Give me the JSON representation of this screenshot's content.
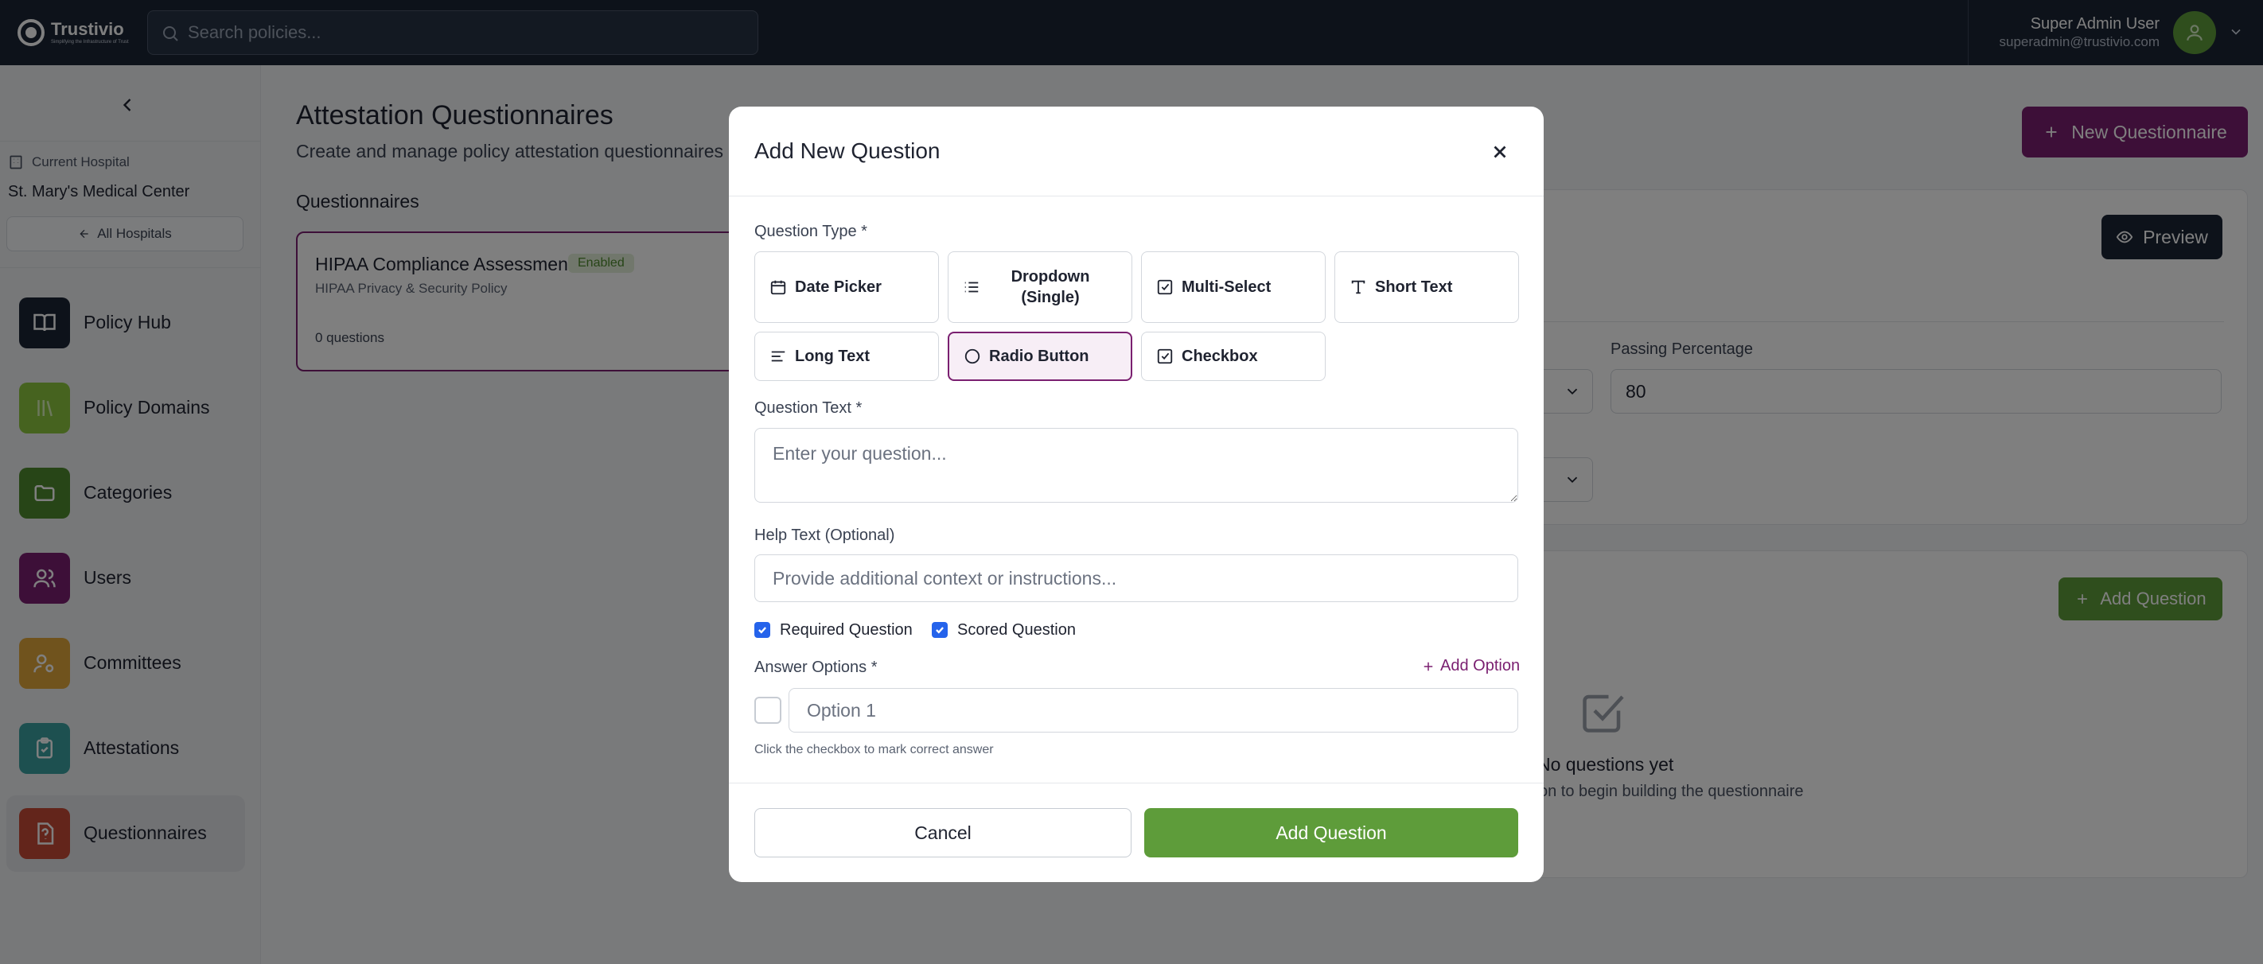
{
  "header": {
    "logo_name": "Trustivio",
    "logo_tagline": "Simplifying the Infrastructure of Trust",
    "search_placeholder": "Search policies...",
    "user_name": "Super Admin User",
    "user_email": "superadmin@trustivio.com"
  },
  "sidebar": {
    "current_hospital_label": "Current Hospital",
    "hospital_name": "St. Mary's Medical Center",
    "all_hospitals_label": "All Hospitals",
    "items": [
      {
        "label": "Policy Hub",
        "icon": "book-icon",
        "color": "#1b2535"
      },
      {
        "label": "Policy Domains",
        "icon": "library-icon",
        "color": "#8cc63f"
      },
      {
        "label": "Categories",
        "icon": "folder-icon",
        "color": "#4f8a2e"
      },
      {
        "label": "Users",
        "icon": "users-icon",
        "color": "#7a1f70"
      },
      {
        "label": "Committees",
        "icon": "committee-icon",
        "color": "#e0a63a"
      },
      {
        "label": "Attestations",
        "icon": "clipboard-check-icon",
        "color": "#3aa0a0"
      },
      {
        "label": "Questionnaires",
        "icon": "file-question-icon",
        "color": "#c64a36"
      }
    ],
    "active_item": "Questionnaires"
  },
  "main": {
    "title": "Attestation Questionnaires",
    "subtitle": "Create and manage policy attestation questionnaires",
    "new_button": "New Questionnaire",
    "list_heading": "Questionnaires",
    "card": {
      "title": "HIPAA Compliance Assessment",
      "badge": "Enabled",
      "policy": "HIPAA Privacy & Security Policy",
      "count": "0 questions"
    },
    "preview_button": "Preview",
    "passing_percentage_label": "Passing Percentage",
    "passing_percentage_value": "80",
    "add_question_button": "Add Question",
    "empty_title": "No questions yet",
    "empty_sub": "on to begin building the questionnaire"
  },
  "modal": {
    "title": "Add New Question",
    "question_type_label": "Question Type *",
    "types": [
      {
        "label": "Date Picker",
        "icon": "calendar-icon"
      },
      {
        "label": "Dropdown (Single)",
        "icon": "list-icon"
      },
      {
        "label": "Multi-Select",
        "icon": "check-square-icon"
      },
      {
        "label": "Short Text",
        "icon": "type-icon"
      },
      {
        "label": "Long Text",
        "icon": "align-left-icon"
      },
      {
        "label": "Radio Button",
        "icon": "circle-icon"
      },
      {
        "label": "Checkbox",
        "icon": "check-square-icon"
      }
    ],
    "selected_type": "Radio Button",
    "question_text_label": "Question Text *",
    "question_text_placeholder": "Enter your question...",
    "help_text_label": "Help Text (Optional)",
    "help_text_placeholder": "Provide additional context or instructions...",
    "required_label": "Required Question",
    "scored_label": "Scored Question",
    "answer_options_label": "Answer Options *",
    "add_option_label": "Add Option",
    "option_1_placeholder": "Option 1",
    "hint": "Click the checkbox to mark correct answer",
    "cancel_label": "Cancel",
    "submit_label": "Add Question"
  },
  "colors": {
    "topbar": "#1b2535",
    "accent_purple": "#7a1f70",
    "accent_green": "#5e9c3a"
  }
}
